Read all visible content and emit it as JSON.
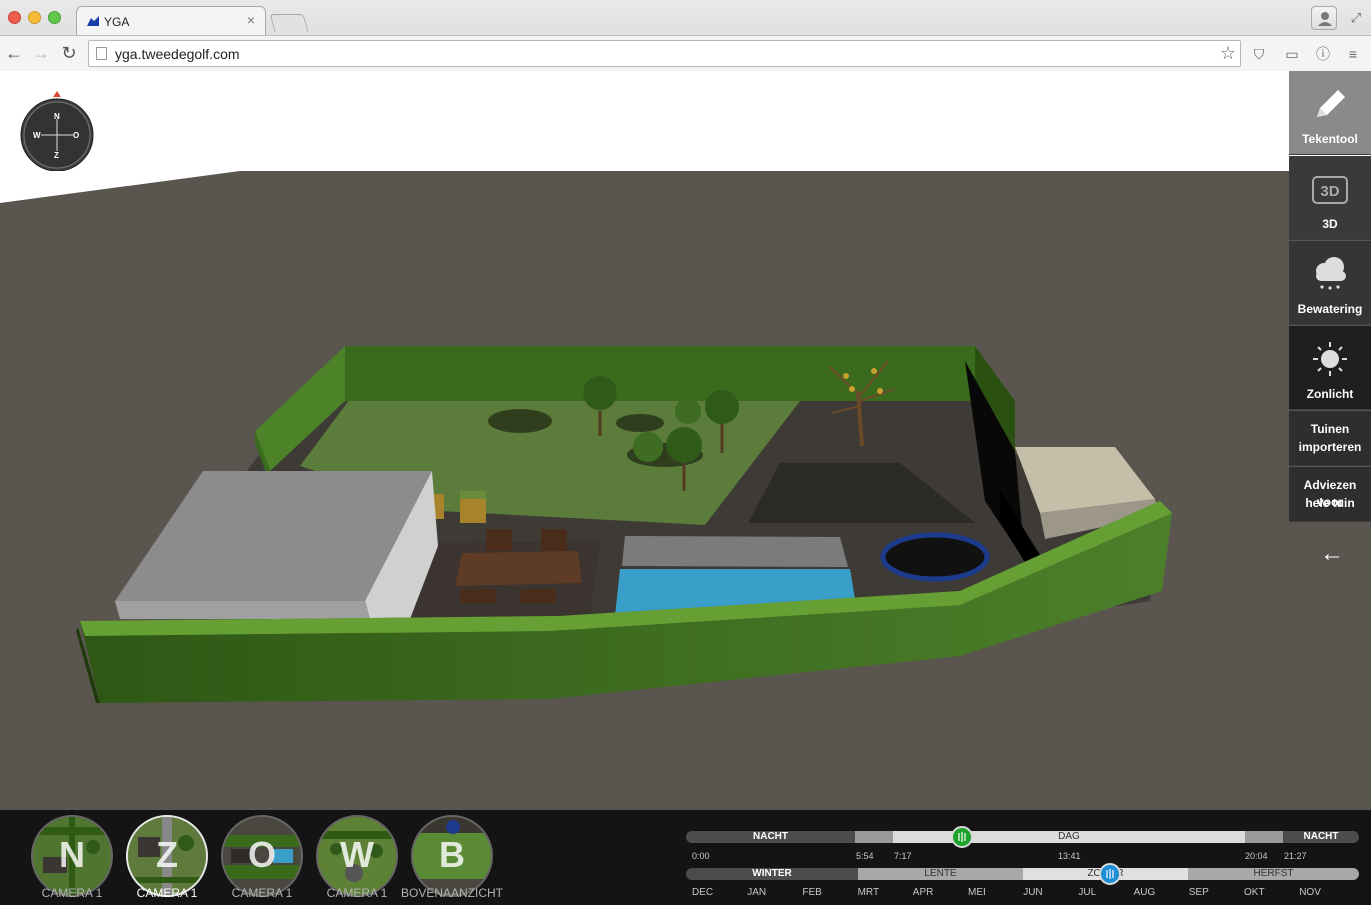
{
  "browser": {
    "tab_title": "YGA",
    "tab_close": "×",
    "url": "yga.tweedegolf.com",
    "icons": {
      "back": "arrow-left-icon",
      "forward": "arrow-right-icon",
      "reload": "reload-icon",
      "star": "star-icon",
      "profile": "user-icon",
      "fullscreen": "expand-icon"
    }
  },
  "compass": {
    "north": "N",
    "south": "Z",
    "west": "W",
    "east": "O"
  },
  "sidebar": {
    "items": [
      {
        "id": "tekentool",
        "label": "Tekentool",
        "icon": "pencil-icon",
        "active": true
      },
      {
        "id": "3d",
        "label": "3D",
        "icon": "3d-icon"
      },
      {
        "id": "bewatering",
        "label": "Bewatering",
        "icon": "rain-cloud-icon"
      },
      {
        "id": "zonlicht",
        "label": "Zonlicht",
        "icon": "sun-icon",
        "selected": true
      },
      {
        "id": "tuinen",
        "label_line1": "Tuinen",
        "label_line2": "importeren"
      },
      {
        "id": "adviezen",
        "label_line1": "Adviezen voor",
        "label_line2": "hele tuin"
      }
    ],
    "back_arrow": "←"
  },
  "cameras": [
    {
      "letter": "N",
      "label": "CAMERA 1",
      "active": false
    },
    {
      "letter": "Z",
      "label": "CAMERA 1",
      "active": true
    },
    {
      "letter": "O",
      "label": "CAMERA 1",
      "active": false
    },
    {
      "letter": "W",
      "label": "CAMERA 1",
      "active": false
    },
    {
      "letter": "B",
      "label": "BOVENAANZICHT",
      "active": false
    }
  ],
  "time_slider": {
    "segments": [
      "NACHT",
      "DAG",
      "NACHT"
    ],
    "ticks": [
      "0:00",
      "5:54",
      "7:17",
      "13:41",
      "20:04",
      "21:27"
    ],
    "value_fraction": 0.41,
    "knob_color": "#1ea32a"
  },
  "season_slider": {
    "segments": [
      "WINTER",
      "LENTE",
      "ZOMER",
      "HERFST"
    ],
    "months": [
      "DEC",
      "JAN",
      "FEB",
      "MRT",
      "APR",
      "MEI",
      "JUN",
      "JUL",
      "AUG",
      "SEP",
      "OKT",
      "NOV"
    ],
    "value_fraction": 0.63,
    "knob_color": "#1e8fd6"
  },
  "colors": {
    "sidebar_active": "#8a8a8a",
    "hedge": "#3f6f1f",
    "lawn": "#5b7c3a",
    "ground": "#5a554f",
    "pool": "#3a9fc8"
  }
}
